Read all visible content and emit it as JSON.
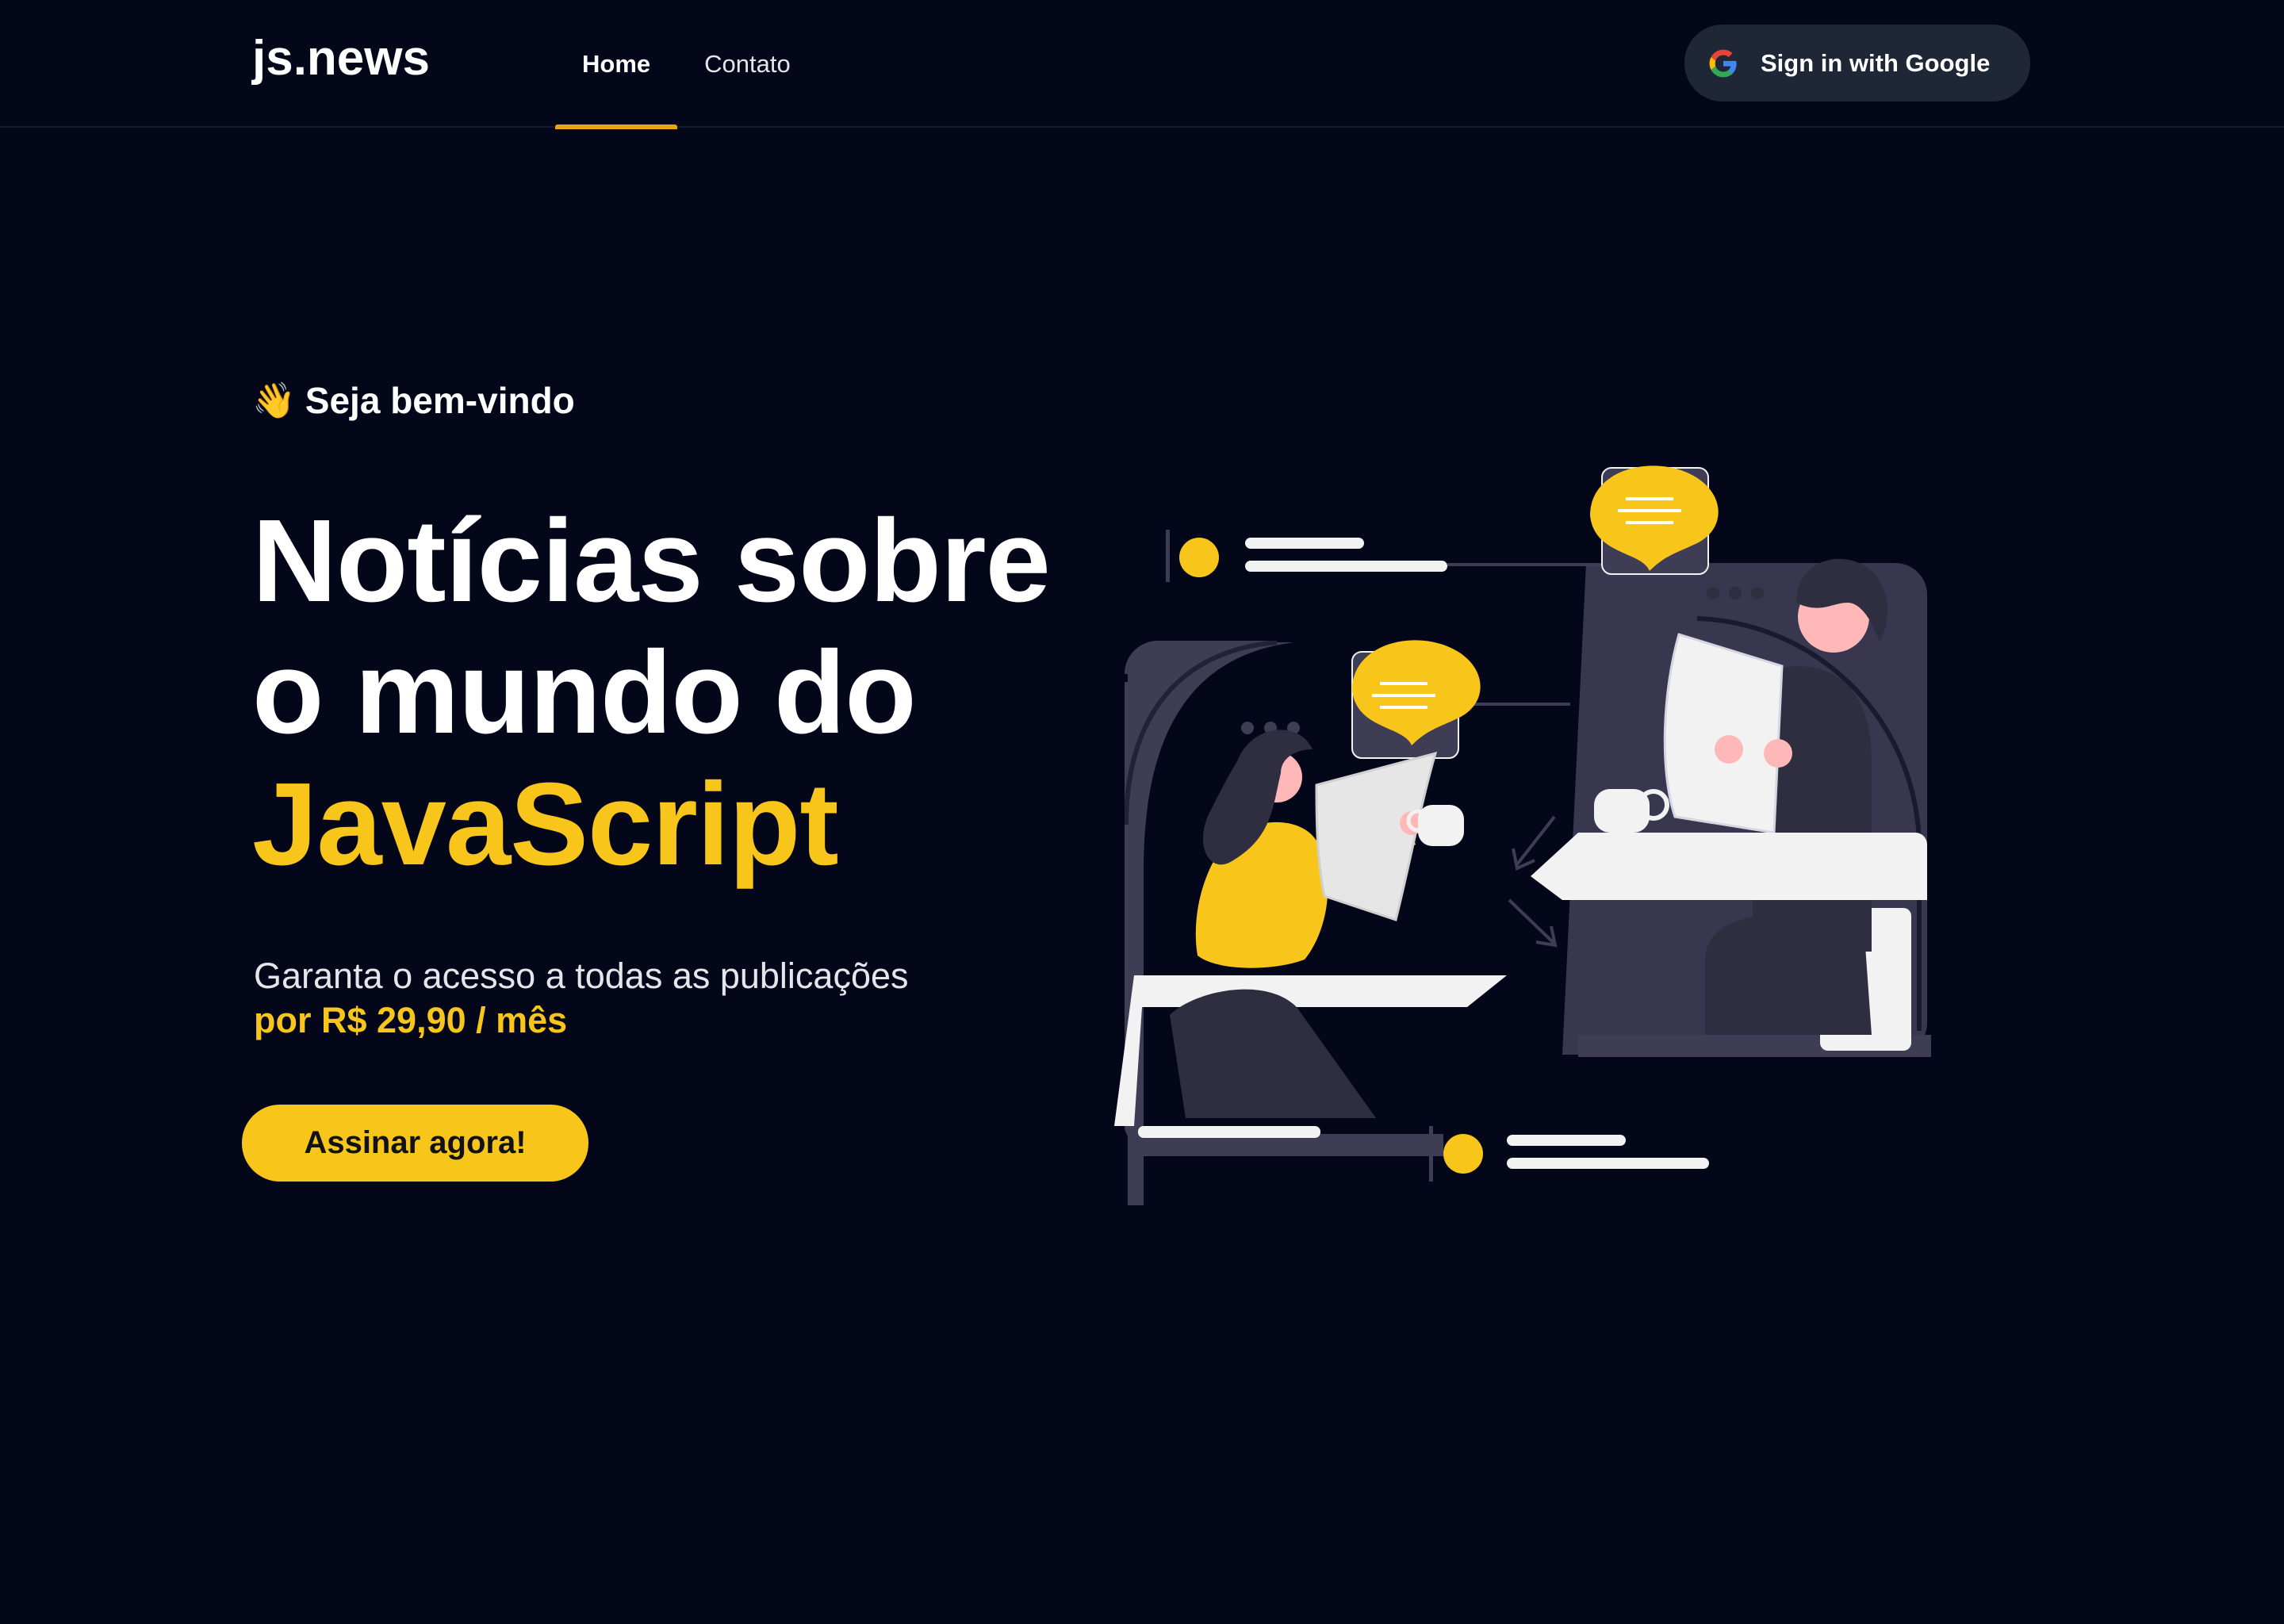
{
  "header": {
    "logo": "js.news",
    "nav": [
      {
        "label": "Home",
        "active": true
      },
      {
        "label": "Contato",
        "active": false
      }
    ],
    "signin_label": "Sign in with Google"
  },
  "hero": {
    "welcome_emoji": "👋",
    "welcome": "Seja bem-vindo",
    "headline_line1": "Notícias sobre",
    "headline_line2": "o mundo do",
    "headline_accent": "JavaScript",
    "subtitle": "Garanta o acesso a todas as publicações",
    "price": "por R$ 29,90 / mês",
    "cta_label": "Assinar agora!"
  },
  "colors": {
    "background": "#04071a",
    "accent": "#f8c61a",
    "nav_underline": "#eba417",
    "button_dark": "#1f2737"
  },
  "icons": [
    "google-icon",
    "waving-hand-icon",
    "reading-people-illustration"
  ]
}
